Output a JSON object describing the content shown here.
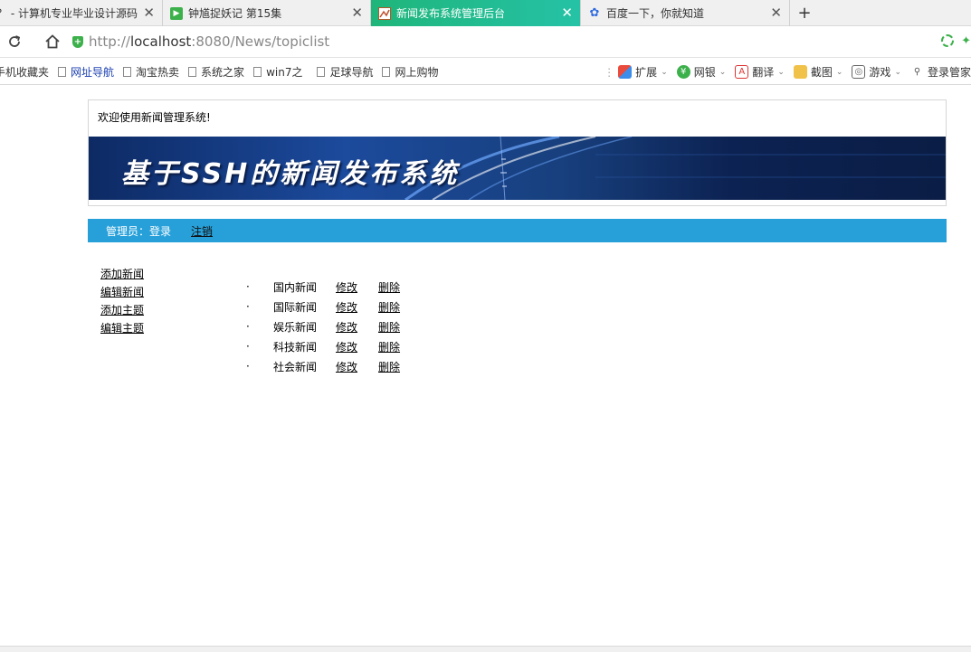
{
  "tabs": [
    {
      "label": "？ - 计算机专业毕业设计源码",
      "icon": "page-icon",
      "active": false
    },
    {
      "label": "钟馗捉妖记 第15集",
      "icon": "video-icon",
      "active": false
    },
    {
      "label": "新闻发布系统管理后台",
      "icon": "image-icon",
      "active": true
    },
    {
      "label": "百度一下，你就知道",
      "icon": "baidu-paw-icon",
      "active": false
    }
  ],
  "new_tab_label": "+",
  "tab_close_glyph": "✕",
  "address": {
    "scheme": "http://",
    "host": "localhost",
    "path": ":8080/News/topiclist"
  },
  "bookmarks": [
    {
      "label": "手机收藏夹",
      "blue": false,
      "icon": false
    },
    {
      "label": "网址导航",
      "blue": true,
      "icon": true
    },
    {
      "label": "淘宝热卖",
      "blue": false,
      "icon": true
    },
    {
      "label": "系统之家",
      "blue": false,
      "icon": true
    },
    {
      "label": "win7之",
      "blue": false,
      "icon": true
    },
    {
      "label": "足球导航",
      "blue": false,
      "icon": true
    },
    {
      "label": "网上购物",
      "blue": false,
      "icon": true
    }
  ],
  "tools": [
    {
      "label": "扩展",
      "icon": "extensions-icon"
    },
    {
      "label": "网银",
      "icon": "bank-icon"
    },
    {
      "label": "翻译",
      "icon": "translate-icon"
    },
    {
      "label": "截图",
      "icon": "screenshot-icon"
    },
    {
      "label": "游戏",
      "icon": "game-icon"
    },
    {
      "label": "登录管家",
      "icon": "login-manager-icon"
    }
  ],
  "page": {
    "welcome": "欢迎使用新闻管理系统!",
    "banner_title": "基于SSH的新闻发布系统",
    "nav_label": "管理员：",
    "nav_login": "登录",
    "nav_logout": "注销",
    "sidebar": [
      "添加新闻",
      "编辑新闻",
      "添加主题",
      "编辑主题"
    ],
    "topic_bullet": "·",
    "topic_edit": "修改",
    "topic_delete": "删除",
    "topics": [
      "国内新闻",
      "国际新闻",
      "娱乐新闻",
      "科技新闻",
      "社会新闻"
    ]
  },
  "colors": {
    "active_tab": "#1fb57a",
    "nav_bar": "#27a0d9",
    "banner": "#1c4a9c"
  }
}
